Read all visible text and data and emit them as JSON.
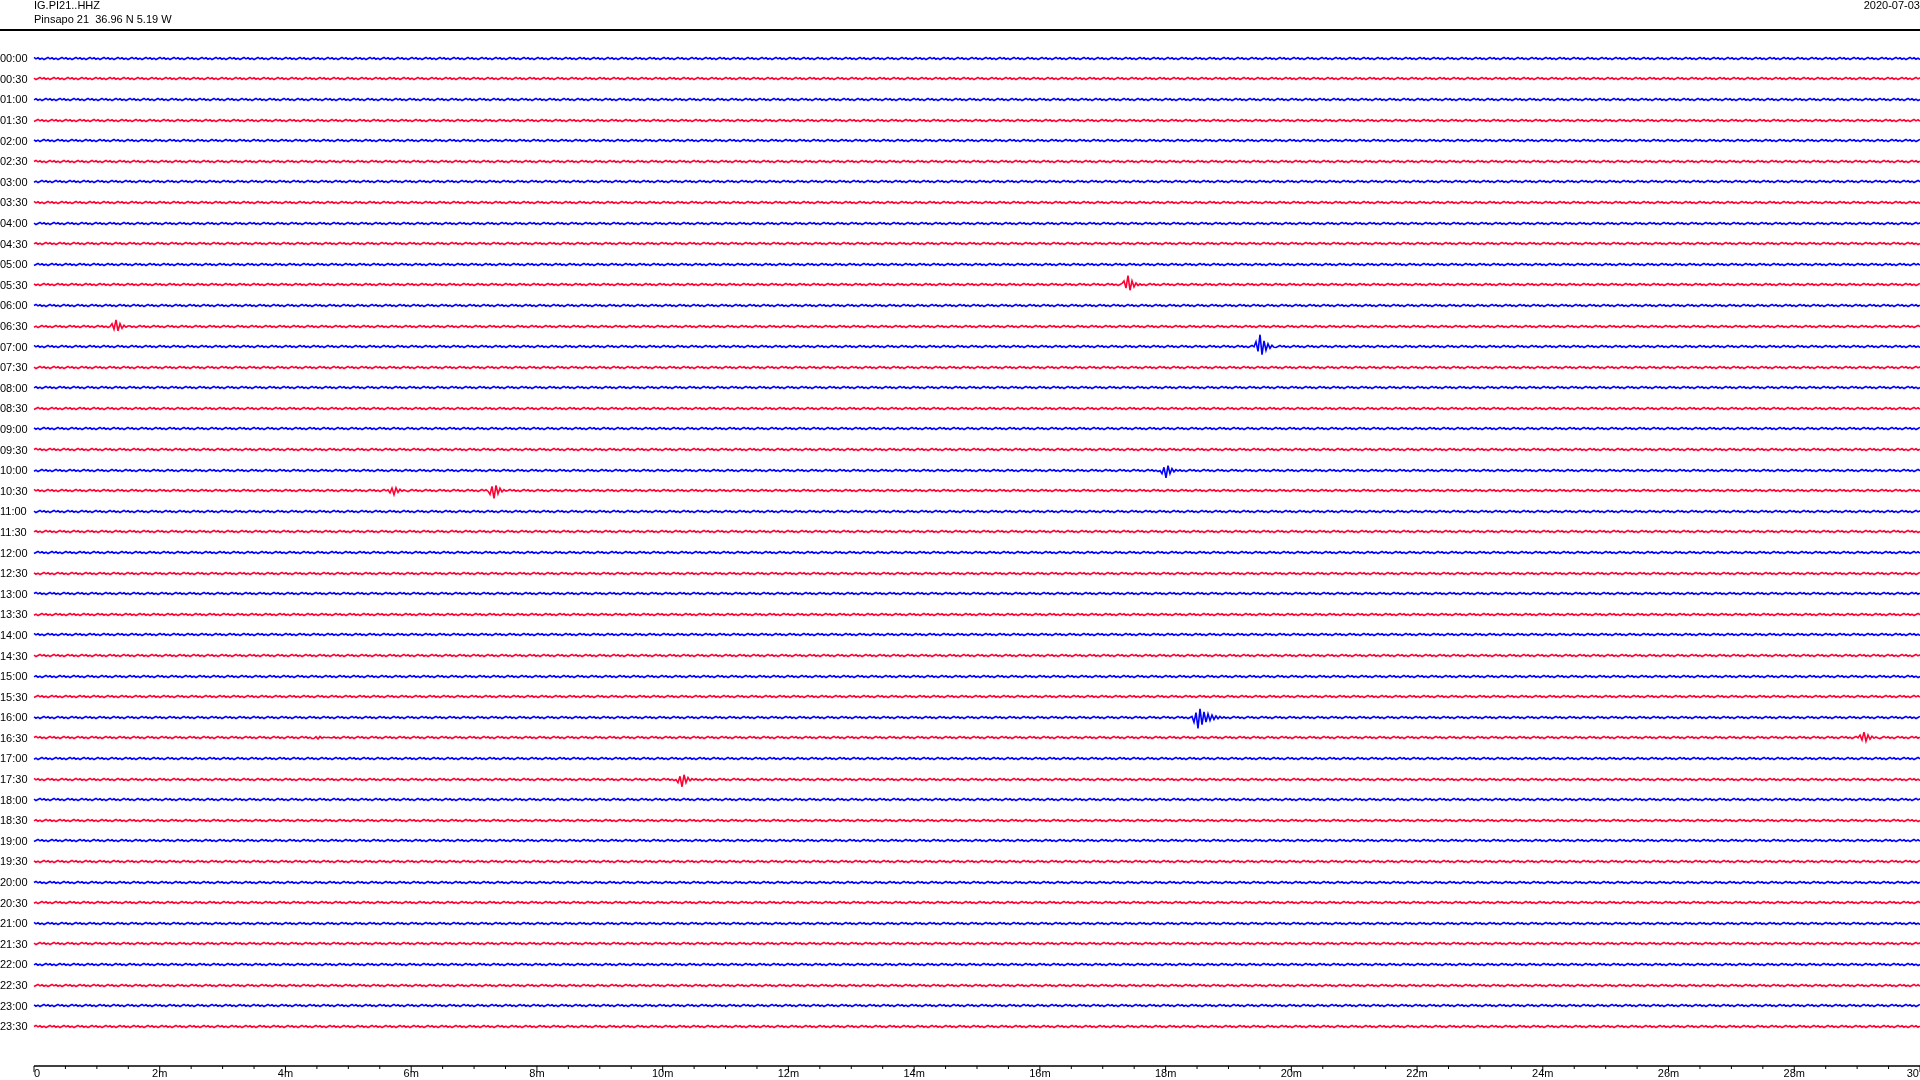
{
  "header": {
    "station": "IG.PI21..HHZ",
    "location": "Pinsapo 21  36.96 N 5.19 W",
    "date": "2020-07-03"
  },
  "rows": [
    {
      "label": "00:00",
      "color": "#0000ff"
    },
    {
      "label": "00:30",
      "color": "#ff0033"
    },
    {
      "label": "01:00",
      "color": "#0000ff"
    },
    {
      "label": "01:30",
      "color": "#ff0033"
    },
    {
      "label": "02:00",
      "color": "#0000ff"
    },
    {
      "label": "02:30",
      "color": "#ff0033"
    },
    {
      "label": "03:00",
      "color": "#0000ff"
    },
    {
      "label": "03:30",
      "color": "#ff0033"
    },
    {
      "label": "04:00",
      "color": "#0000ff"
    },
    {
      "label": "04:30",
      "color": "#ff0033"
    },
    {
      "label": "05:00",
      "color": "#0000ff"
    },
    {
      "label": "05:30",
      "color": "#ff0033"
    },
    {
      "label": "06:00",
      "color": "#0000ff"
    },
    {
      "label": "06:30",
      "color": "#ff0033"
    },
    {
      "label": "07:00",
      "color": "#0000ff"
    },
    {
      "label": "07:30",
      "color": "#ff0033"
    },
    {
      "label": "08:00",
      "color": "#0000ff"
    },
    {
      "label": "08:30",
      "color": "#ff0033"
    },
    {
      "label": "09:00",
      "color": "#0000ff"
    },
    {
      "label": "09:30",
      "color": "#ff0033"
    },
    {
      "label": "10:00",
      "color": "#0000ff"
    },
    {
      "label": "10:30",
      "color": "#ff0033"
    },
    {
      "label": "11:00",
      "color": "#0000ff"
    },
    {
      "label": "11:30",
      "color": "#ff0033"
    },
    {
      "label": "12:00",
      "color": "#0000ff"
    },
    {
      "label": "12:30",
      "color": "#ff0033"
    },
    {
      "label": "13:00",
      "color": "#0000ff"
    },
    {
      "label": "13:30",
      "color": "#ff0033"
    },
    {
      "label": "14:00",
      "color": "#0000ff"
    },
    {
      "label": "14:30",
      "color": "#ff0033"
    },
    {
      "label": "15:00",
      "color": "#0000ff"
    },
    {
      "label": "15:30",
      "color": "#ff0033"
    },
    {
      "label": "16:00",
      "color": "#0000ff"
    },
    {
      "label": "16:30",
      "color": "#ff0033"
    },
    {
      "label": "17:00",
      "color": "#0000ff"
    },
    {
      "label": "17:30",
      "color": "#ff0033"
    },
    {
      "label": "18:00",
      "color": "#0000ff"
    },
    {
      "label": "18:30",
      "color": "#ff0033"
    },
    {
      "label": "19:00",
      "color": "#0000ff"
    },
    {
      "label": "19:30",
      "color": "#ff0033"
    },
    {
      "label": "20:00",
      "color": "#0000ff"
    },
    {
      "label": "20:30",
      "color": "#ff0033"
    },
    {
      "label": "21:00",
      "color": "#0000ff"
    },
    {
      "label": "21:30",
      "color": "#ff0033"
    },
    {
      "label": "22:00",
      "color": "#0000ff"
    },
    {
      "label": "22:30",
      "color": "#ff0033"
    },
    {
      "label": "23:00",
      "color": "#0000ff"
    },
    {
      "label": "23:30",
      "color": "#ff0033"
    }
  ],
  "axis": {
    "labels": [
      "0",
      "2m",
      "4m",
      "6m",
      "8m",
      "10m",
      "12m",
      "14m",
      "16m",
      "18m",
      "20m",
      "22m",
      "24m",
      "26m",
      "28m",
      "30"
    ]
  }
}
